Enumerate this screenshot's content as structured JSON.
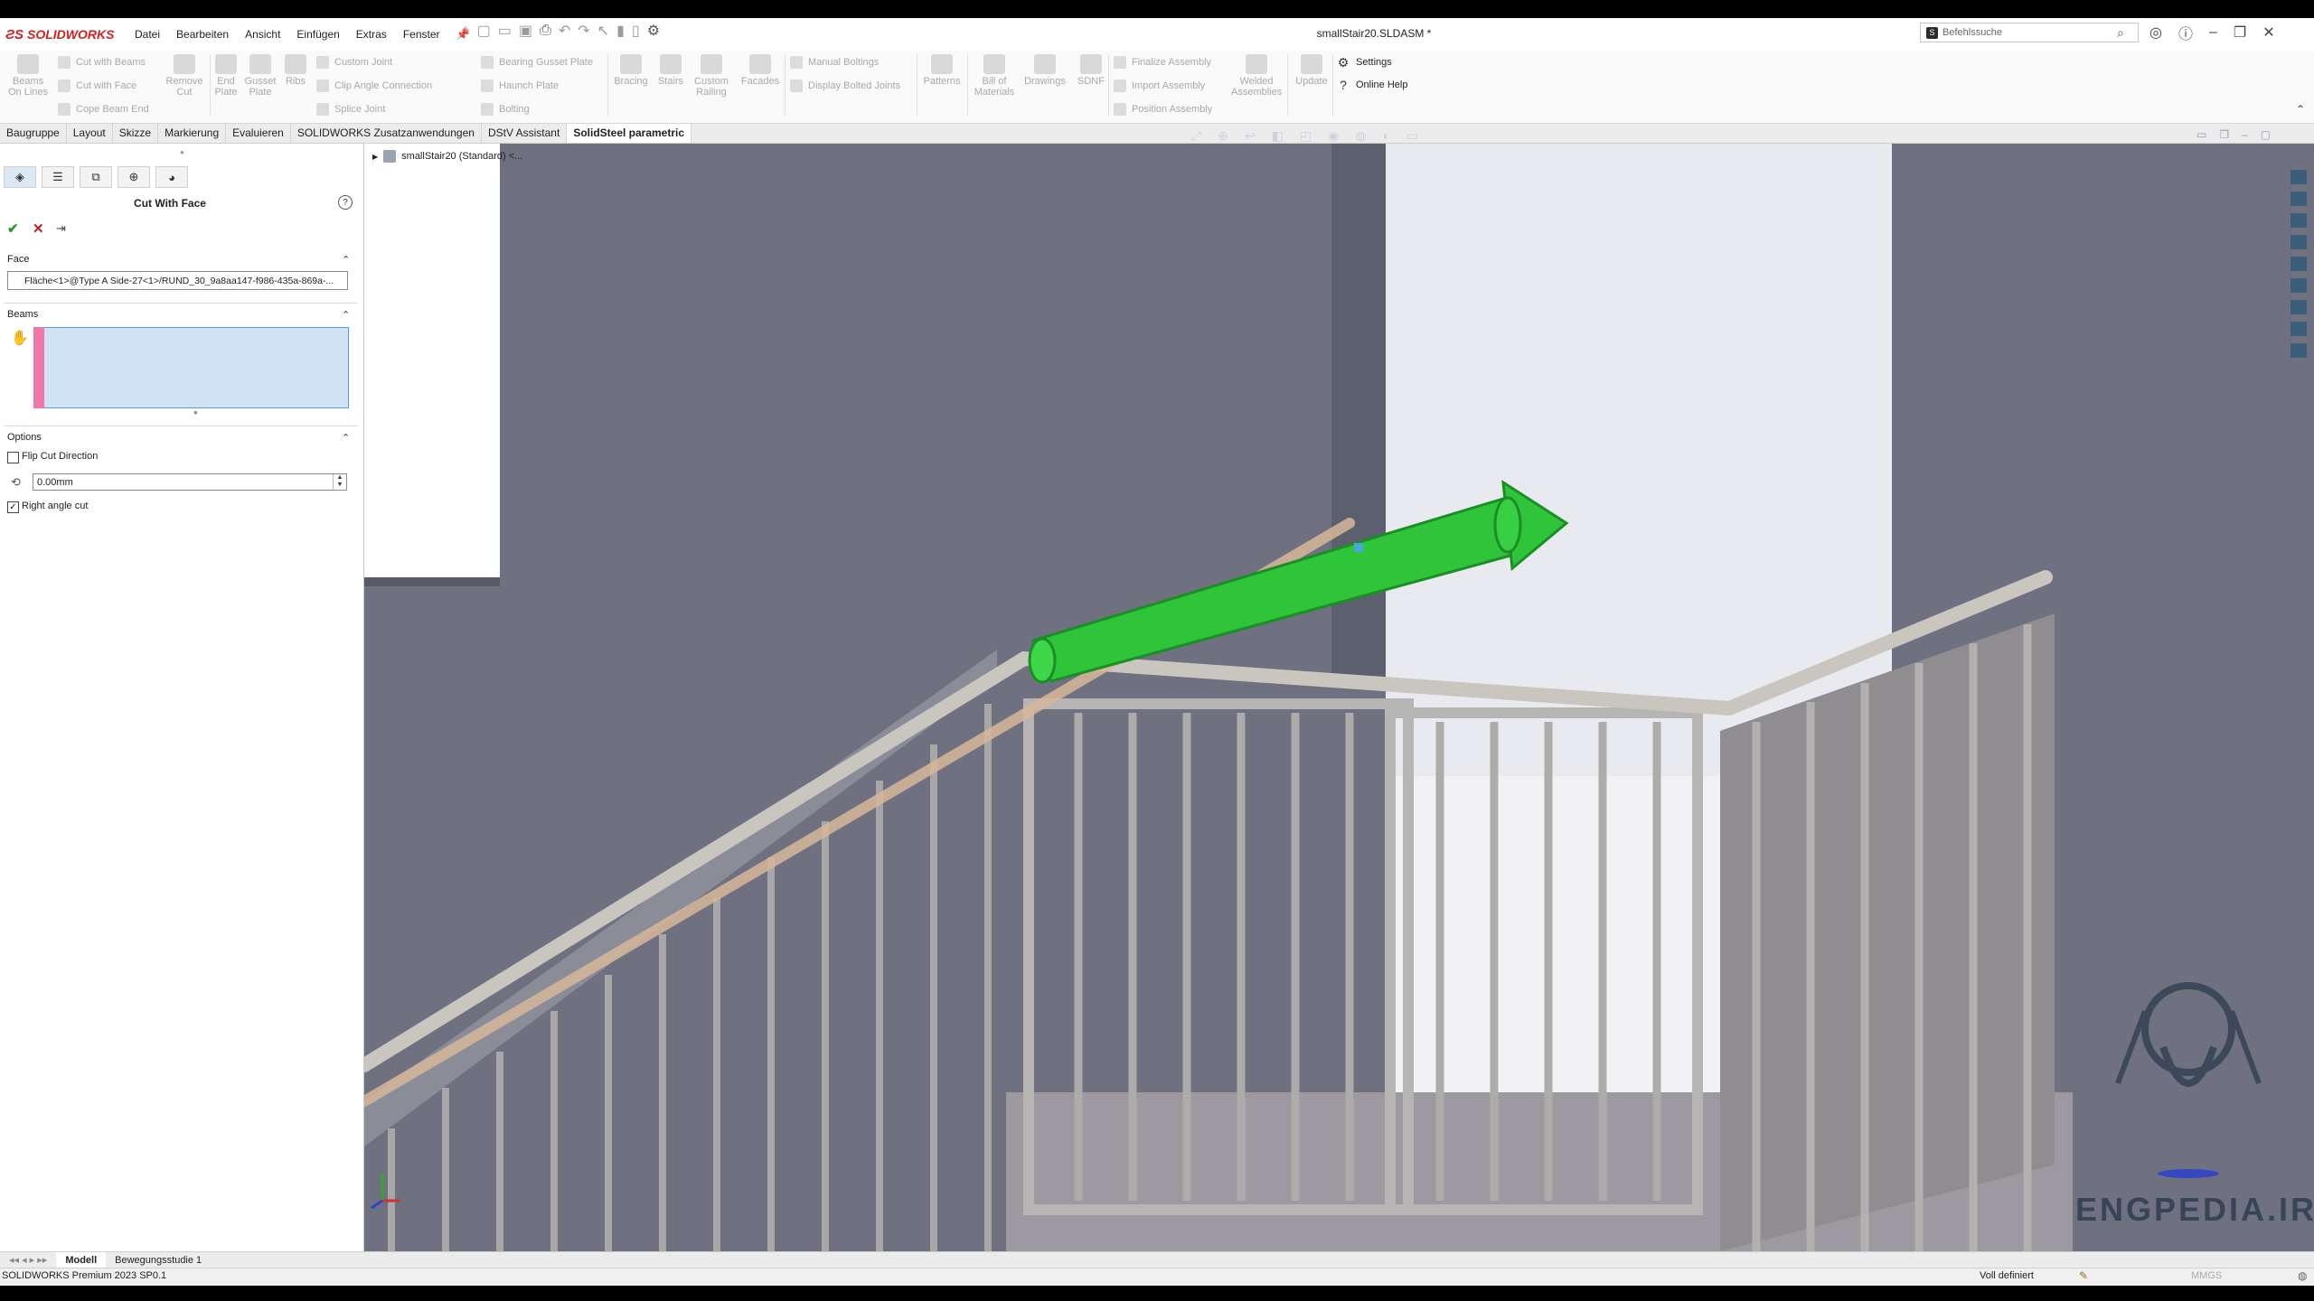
{
  "app": {
    "logo_text": "SOLIDWORKS",
    "doc_title": "smallStair20.SLDASM *"
  },
  "menu": [
    "Datei",
    "Bearbeiten",
    "Ansicht",
    "Einfügen",
    "Extras",
    "Fenster"
  ],
  "search": {
    "placeholder": "Befehlssuche"
  },
  "ribbon": {
    "beams_on_lines": "Beams\nOn Lines",
    "cut_with_beams": "Cut with Beams",
    "cut_with_face": "Cut with Face",
    "cope_beam_end": "Cope Beam End",
    "remove_cut": "Remove\nCut",
    "end_plate": "End\nPlate",
    "gusset_plate": "Gusset\nPlate",
    "ribs": "Ribs",
    "custom_joint": "Custom Joint",
    "clip_angle_connection": "Clip Angle Connection",
    "splice_joint": "Splice Joint",
    "bearing_gusset_plate": "Bearing Gusset Plate",
    "haunch_plate": "Haunch Plate",
    "bolting": "Bolting",
    "bracing": "Bracing",
    "stairs": "Stairs",
    "custom_railing": "Custom\nRailing",
    "facades": "Facades",
    "manual_boltings": "Manual Boltings",
    "display_bolted_joints": "Display Bolted Joints",
    "patterns": "Patterns",
    "bill_of_materials": "Bill of\nMaterials",
    "drawings": "Drawings",
    "sdnf": "SDNF",
    "finalize_assembly": "Finalize Assembly",
    "import_assembly": "Import Assembly",
    "position_assembly": "Position Assembly",
    "welded_assemblies": "Welded\nAssemblies",
    "update": "Update",
    "settings": "Settings",
    "online_help": "Online Help"
  },
  "command_tabs": [
    "Baugruppe",
    "Layout",
    "Skizze",
    "Markierung",
    "Evaluieren",
    "SOLIDWORKS Zusatzanwendungen",
    "DStV Assistant",
    "SolidSteel parametric"
  ],
  "active_command_tab": "SolidSteel parametric",
  "property_manager": {
    "title": "Cut With Face",
    "help": "?",
    "face_group": {
      "label": "Face",
      "value": "Fläche<1>@Type A Side-27<1>/RUND_30_9a8aa147-f986-435a-869a-..."
    },
    "beams_group": {
      "label": "Beams"
    },
    "options_group": {
      "label": "Options",
      "flip_cut_direction": {
        "label": "Flip Cut Direction",
        "checked": false
      },
      "offset": "0.00mm",
      "right_angle_cut": {
        "label": "Right angle cut",
        "checked": true
      }
    }
  },
  "feature_tree": {
    "root": "smallStair20 (Standard) <..."
  },
  "bottom_tabs": [
    "Modell",
    "Bewegungsstudie 1"
  ],
  "active_bottom_tab": "Modell",
  "status": {
    "left": "SOLIDWORKS Premium 2023 SP0.1",
    "definition": "Voll definiert",
    "units": "MMGS"
  },
  "watermark": "ENGPEDIA.IR",
  "colors": {
    "viewport_bg": "#6f7080",
    "arrow": "#2fc43a",
    "railing": "#c9c5bf",
    "brand_red": "#d02020"
  }
}
